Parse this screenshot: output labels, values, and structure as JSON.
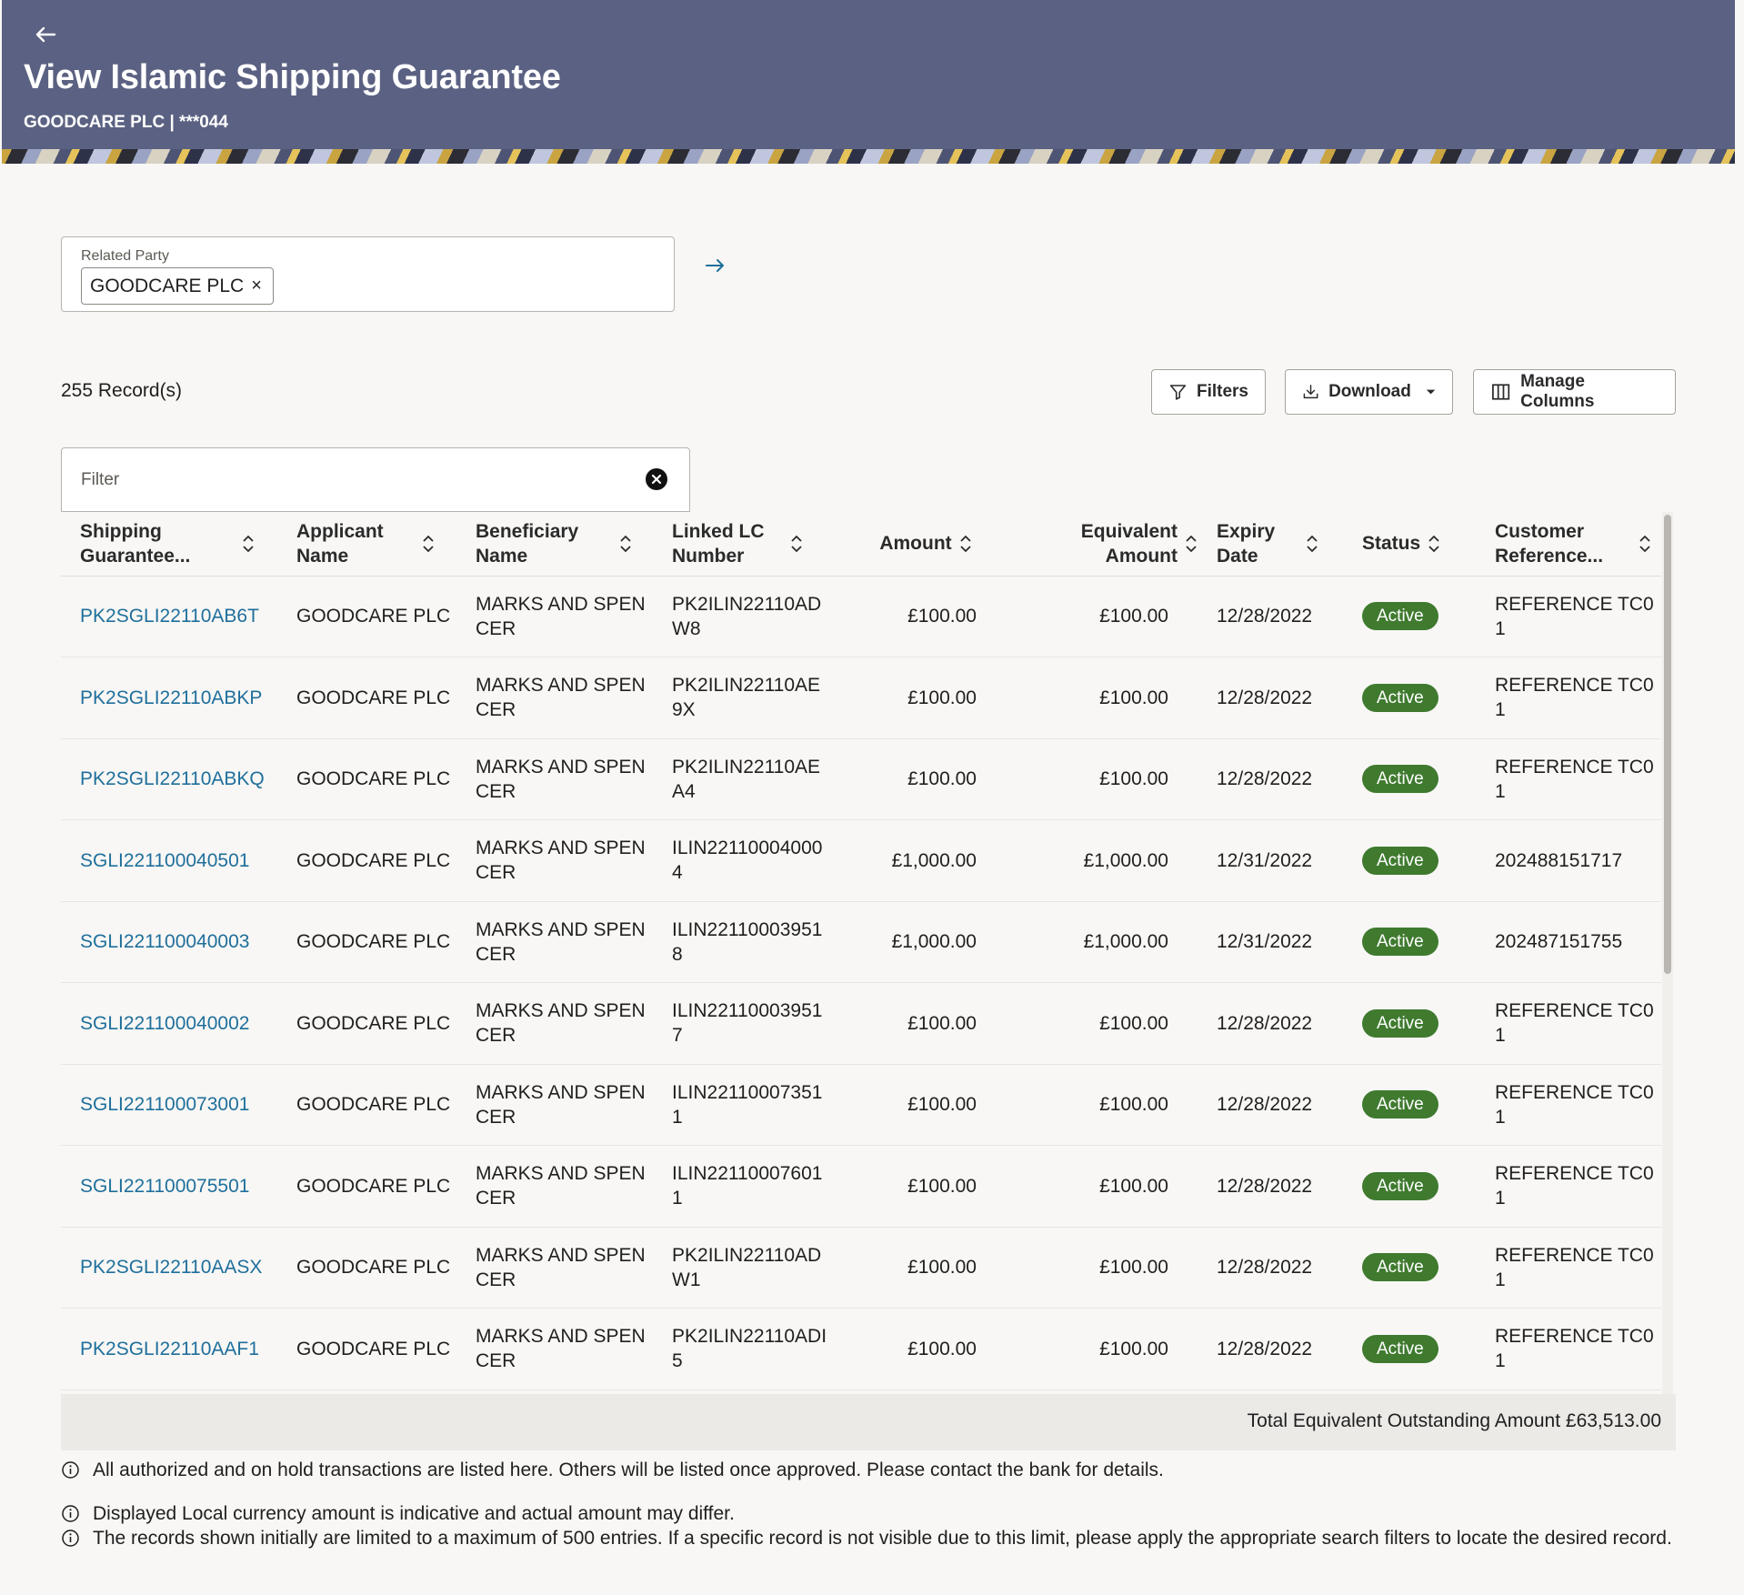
{
  "header": {
    "title": "View Islamic Shipping Guarantee",
    "subtitle": "GOODCARE PLC | ***044"
  },
  "related_party": {
    "label": "Related Party",
    "chip": "GOODCARE PLC",
    "chip_remove": "×"
  },
  "toolbar": {
    "records": "255 Record(s)",
    "filters_label": "Filters",
    "download_label": "Download",
    "manage_columns_label": "Manage Columns"
  },
  "filter": {
    "placeholder": "Filter",
    "value": ""
  },
  "table": {
    "columns": [
      "Shipping Guarantee...",
      "Applicant Name",
      "Beneficiary Name",
      "Linked LC Number",
      "Amount",
      "Equivalent Amount",
      "Expiry Date",
      "Status",
      "Customer Reference..."
    ],
    "rows": [
      {
        "ref": "PK2SGLI22110AB6T",
        "applicant": "GOODCARE PLC",
        "beneficiary": "MARKS AND SPENCER",
        "lc": "PK2ILIN22110ADW8",
        "amount": "£100.00",
        "equivalent": "£100.00",
        "expiry": "12/28/2022",
        "status": "Active",
        "customer_ref": "REFERENCE TC01"
      },
      {
        "ref": "PK2SGLI22110ABKP",
        "applicant": "GOODCARE PLC",
        "beneficiary": "MARKS AND SPENCER",
        "lc": "PK2ILIN22110AE9X",
        "amount": "£100.00",
        "equivalent": "£100.00",
        "expiry": "12/28/2022",
        "status": "Active",
        "customer_ref": "REFERENCE TC01"
      },
      {
        "ref": "PK2SGLI22110ABKQ",
        "applicant": "GOODCARE PLC",
        "beneficiary": "MARKS AND SPENCER",
        "lc": "PK2ILIN22110AEA4",
        "amount": "£100.00",
        "equivalent": "£100.00",
        "expiry": "12/28/2022",
        "status": "Active",
        "customer_ref": "REFERENCE TC01"
      },
      {
        "ref": "SGLI221100040501",
        "applicant": "GOODCARE PLC",
        "beneficiary": "MARKS AND SPENCER",
        "lc": "ILIN221100040004",
        "amount": "£1,000.00",
        "equivalent": "£1,000.00",
        "expiry": "12/31/2022",
        "status": "Active",
        "customer_ref": "202488151717"
      },
      {
        "ref": "SGLI221100040003",
        "applicant": "GOODCARE PLC",
        "beneficiary": "MARKS AND SPENCER",
        "lc": "ILIN221100039518",
        "amount": "£1,000.00",
        "equivalent": "£1,000.00",
        "expiry": "12/31/2022",
        "status": "Active",
        "customer_ref": "202487151755"
      },
      {
        "ref": "SGLI221100040002",
        "applicant": "GOODCARE PLC",
        "beneficiary": "MARKS AND SPENCER",
        "lc": "ILIN221100039517",
        "amount": "£100.00",
        "equivalent": "£100.00",
        "expiry": "12/28/2022",
        "status": "Active",
        "customer_ref": "REFERENCE TC01"
      },
      {
        "ref": "SGLI221100073001",
        "applicant": "GOODCARE PLC",
        "beneficiary": "MARKS AND SPENCER",
        "lc": "ILIN221100073511",
        "amount": "£100.00",
        "equivalent": "£100.00",
        "expiry": "12/28/2022",
        "status": "Active",
        "customer_ref": "REFERENCE TC01"
      },
      {
        "ref": "SGLI221100075501",
        "applicant": "GOODCARE PLC",
        "beneficiary": "MARKS AND SPENCER",
        "lc": "ILIN221100076011",
        "amount": "£100.00",
        "equivalent": "£100.00",
        "expiry": "12/28/2022",
        "status": "Active",
        "customer_ref": "REFERENCE TC01"
      },
      {
        "ref": "PK2SGLI22110AASX",
        "applicant": "GOODCARE PLC",
        "beneficiary": "MARKS AND SPENCER",
        "lc": "PK2ILIN22110ADW1",
        "amount": "£100.00",
        "equivalent": "£100.00",
        "expiry": "12/28/2022",
        "status": "Active",
        "customer_ref": "REFERENCE TC01"
      },
      {
        "ref": "PK2SGLI22110AAF1",
        "applicant": "GOODCARE PLC",
        "beneficiary": "MARKS AND SPENCER",
        "lc": "PK2ILIN22110ADI5",
        "amount": "£100.00",
        "equivalent": "£100.00",
        "expiry": "12/28/2022",
        "status": "Active",
        "customer_ref": "REFERENCE TC01"
      }
    ]
  },
  "total": "Total Equivalent Outstanding Amount £63,513.00",
  "notes": [
    "All authorized and on hold transactions are listed here. Others will be listed once approved. Please contact the bank for details.",
    "Displayed Local currency amount is indicative and actual amount may differ.",
    "The records shown initially are limited to a maximum of 500 entries. If a specific record is not visible due to this limit, please apply the appropriate search filters to locate the desired record."
  ],
  "colors": {
    "header_bg": "#5b6182",
    "link": "#1f6f9c",
    "status_active": "#3f7a2f"
  },
  "icons": {
    "back": "arrow-left-icon",
    "go": "arrow-right-icon",
    "filters": "funnel-icon",
    "download": "download-icon",
    "caret": "caret-down-icon",
    "manage_columns": "columns-icon",
    "clear": "clear-circle-icon",
    "sort": "sort-icon",
    "info": "info-icon"
  }
}
